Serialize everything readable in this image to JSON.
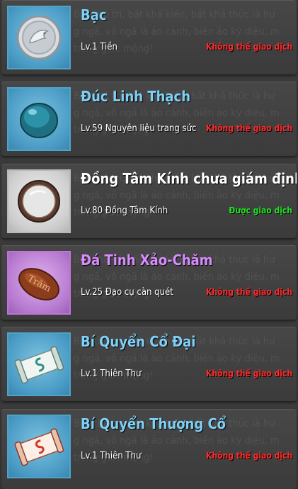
{
  "background_text": {
    "line1": "Bất khả tri, bất khả kiến, bất khả thức là hư",
    "line2": "g ngã, vô ngã là ảo cảnh, biến ảo kỳ diệu, m",
    "line3": "trong giấc mộng!"
  },
  "colors": {
    "name_blue": "#7fd0f6",
    "name_white": "#ffffff",
    "name_purple": "#d98cff",
    "untradeable": "#ff2a2a",
    "tradeable": "#22e022"
  },
  "items": [
    {
      "name": "Bạc",
      "sub": "Lv.1 Tiền",
      "status": "Không thể giao dịch",
      "icon": "silver-coin-icon"
    },
    {
      "name": "Đúc Linh Thạch",
      "sub": "Lv.59 Nguyên liệu trang sức",
      "status": "Không thể giao dịch",
      "icon": "spirit-stone-icon"
    },
    {
      "name": "Đồng Tâm Kính chưa giám định",
      "sub": "Lv.80 Đồng Tâm Kính",
      "status": "Được giao dịch",
      "icon": "mirror-icon"
    },
    {
      "name": "Đá Tinh Xảo-Chăm",
      "sub": "Lv.25 Đạo cụ càn quét",
      "status": "Không thể giao dịch",
      "icon": "seed-stone-icon",
      "stone_text": "Trăm"
    },
    {
      "name": "Bí Quyển Cổ Đại",
      "sub": "Lv.1 Thiên Thư",
      "status": "Không thể giao dịch",
      "icon": "scroll-icon"
    },
    {
      "name": "Bí Quyển Thượng Cổ",
      "sub": "Lv.1 Thiên Thư",
      "status": "Không thể giao dịch",
      "icon": "scroll-red-icon"
    }
  ]
}
